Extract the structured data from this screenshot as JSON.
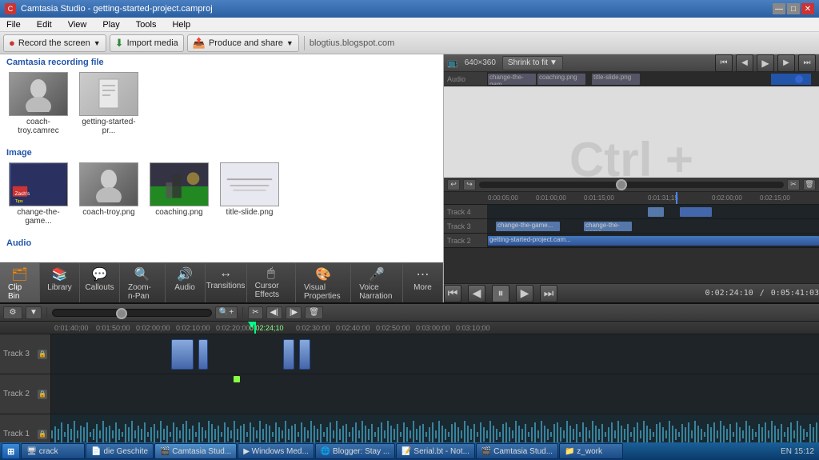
{
  "app": {
    "title": "Camtasia Studio - getting-started-project.camproj",
    "url_display": "blogtius.blogspot.com"
  },
  "titlebar": {
    "title": "Camtasia Studio - getting-started-project.camproj",
    "min": "—",
    "max": "□",
    "close": "✕"
  },
  "menubar": {
    "items": [
      "File",
      "Edit",
      "View",
      "Play",
      "Tools",
      "Help"
    ]
  },
  "toolbar": {
    "record_btn": "Record the screen",
    "import_btn": "Import media",
    "produce_btn": "Produce and share"
  },
  "clip_bin": {
    "section_recording": "Camtasia recording file",
    "section_image": "Image",
    "section_audio": "Audio",
    "clips_recording": [
      {
        "name": "coach-troy.camrec",
        "type": "face"
      },
      {
        "name": "getting-started-pr...",
        "type": "doc"
      }
    ],
    "clips_image": [
      {
        "name": "change-the-game...",
        "type": "game"
      },
      {
        "name": "coach-troy.png",
        "type": "face"
      },
      {
        "name": "coaching.png",
        "type": "outdoor"
      },
      {
        "name": "title-slide.png",
        "type": "slide"
      }
    ]
  },
  "tabs": [
    {
      "id": "clip-bin",
      "label": "Clip Bin",
      "icon": "🗂",
      "active": true
    },
    {
      "id": "library",
      "label": "Library",
      "icon": "📚",
      "active": false
    },
    {
      "id": "callouts",
      "label": "Callouts",
      "icon": "💬",
      "active": false
    },
    {
      "id": "zoom-n-pan",
      "label": "Zoom-n-Pan",
      "icon": "🔍",
      "active": false
    },
    {
      "id": "audio",
      "label": "Audio",
      "icon": "🔊",
      "active": false
    },
    {
      "id": "transitions",
      "label": "Transitions",
      "icon": "↔",
      "active": false
    },
    {
      "id": "cursor-effects",
      "label": "Cursor Effects",
      "icon": "🖱",
      "active": false
    },
    {
      "id": "visual-properties",
      "label": "Visual Properties",
      "icon": "🎨",
      "active": false
    },
    {
      "id": "voice-narration",
      "label": "Voice Narration",
      "icon": "🎤",
      "active": false
    },
    {
      "id": "more",
      "label": "More",
      "icon": "⋯",
      "active": false
    }
  ],
  "preview": {
    "size": "640×360",
    "zoom": "Shrink to fit",
    "time_current": "0:02:24:10",
    "time_total": "0:05:41:03",
    "ctrl_display": "Ctrl +"
  },
  "timeline": {
    "tracks": [
      {
        "name": "Track 4",
        "label": "Track 4"
      },
      {
        "name": "Track 3",
        "label": "Track 3"
      },
      {
        "name": "Track 2",
        "label": "Track 2"
      },
      {
        "name": "Track 1",
        "label": "Track 1"
      }
    ],
    "ruler_marks": [
      "0:01:40;00",
      "0:01:50;00",
      "0:02:00;00",
      "0:02:10;00",
      "0:02:20;00",
      "0:02:24;10",
      "0:02:30;00",
      "0:02:40;00",
      "0:02:50;00",
      "0:03:00;00",
      "0:03:10;00"
    ]
  },
  "taskbar": {
    "start_label": "⊞",
    "items": [
      {
        "label": "crack",
        "icon": "🖥"
      },
      {
        "label": "die Geschite",
        "icon": "📄"
      },
      {
        "label": "Camtasia Stud...",
        "icon": "🎬"
      },
      {
        "label": "Windows Med...",
        "icon": "▶"
      },
      {
        "label": "Blogger: Stay ...",
        "icon": "🌐"
      },
      {
        "label": "Serial.bt - Not...",
        "icon": "📝"
      },
      {
        "label": "Camtasia Stud...",
        "icon": "🎬"
      },
      {
        "label": "z_work",
        "icon": "📁"
      }
    ],
    "tray": {
      "lang": "EN",
      "time": "15:12"
    }
  }
}
